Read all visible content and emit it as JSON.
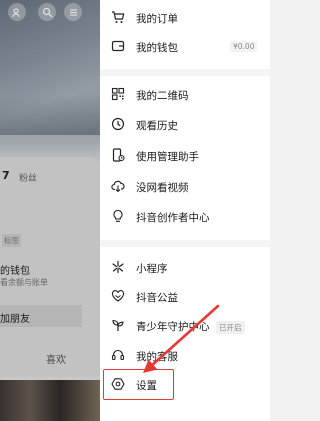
{
  "background": {
    "follower_count": "7",
    "follower_label": "粉丝",
    "tag_label": "标签",
    "wallet_title": "的钱包",
    "wallet_subtitle": "看余额与账单",
    "add_friend_label": "加朋友",
    "like_label": "喜欢"
  },
  "menu": {
    "items": [
      {
        "label": "我的订单",
        "icon": "cart-icon"
      },
      {
        "label": "我的钱包",
        "icon": "wallet-icon",
        "value": "¥0.00"
      },
      {
        "label": "我的二维码",
        "icon": "qrcode-icon"
      },
      {
        "label": "观看历史",
        "icon": "clock-icon"
      },
      {
        "label": "使用管理助手",
        "icon": "phone-timer-icon"
      },
      {
        "label": "没网看视频",
        "icon": "cloud-download-icon"
      },
      {
        "label": "抖音创作者中心",
        "icon": "bulb-icon"
      },
      {
        "label": "小程序",
        "icon": "miniapp-icon"
      },
      {
        "label": "抖音公益",
        "icon": "heart-hands-icon"
      },
      {
        "label": "青少年守护中心",
        "icon": "sprout-icon",
        "badge": "已开启"
      },
      {
        "label": "我的客服",
        "icon": "headset-icon"
      },
      {
        "label": "设置",
        "icon": "settings-hexagon-icon"
      }
    ]
  },
  "annotation": {
    "color": "#e53935"
  }
}
